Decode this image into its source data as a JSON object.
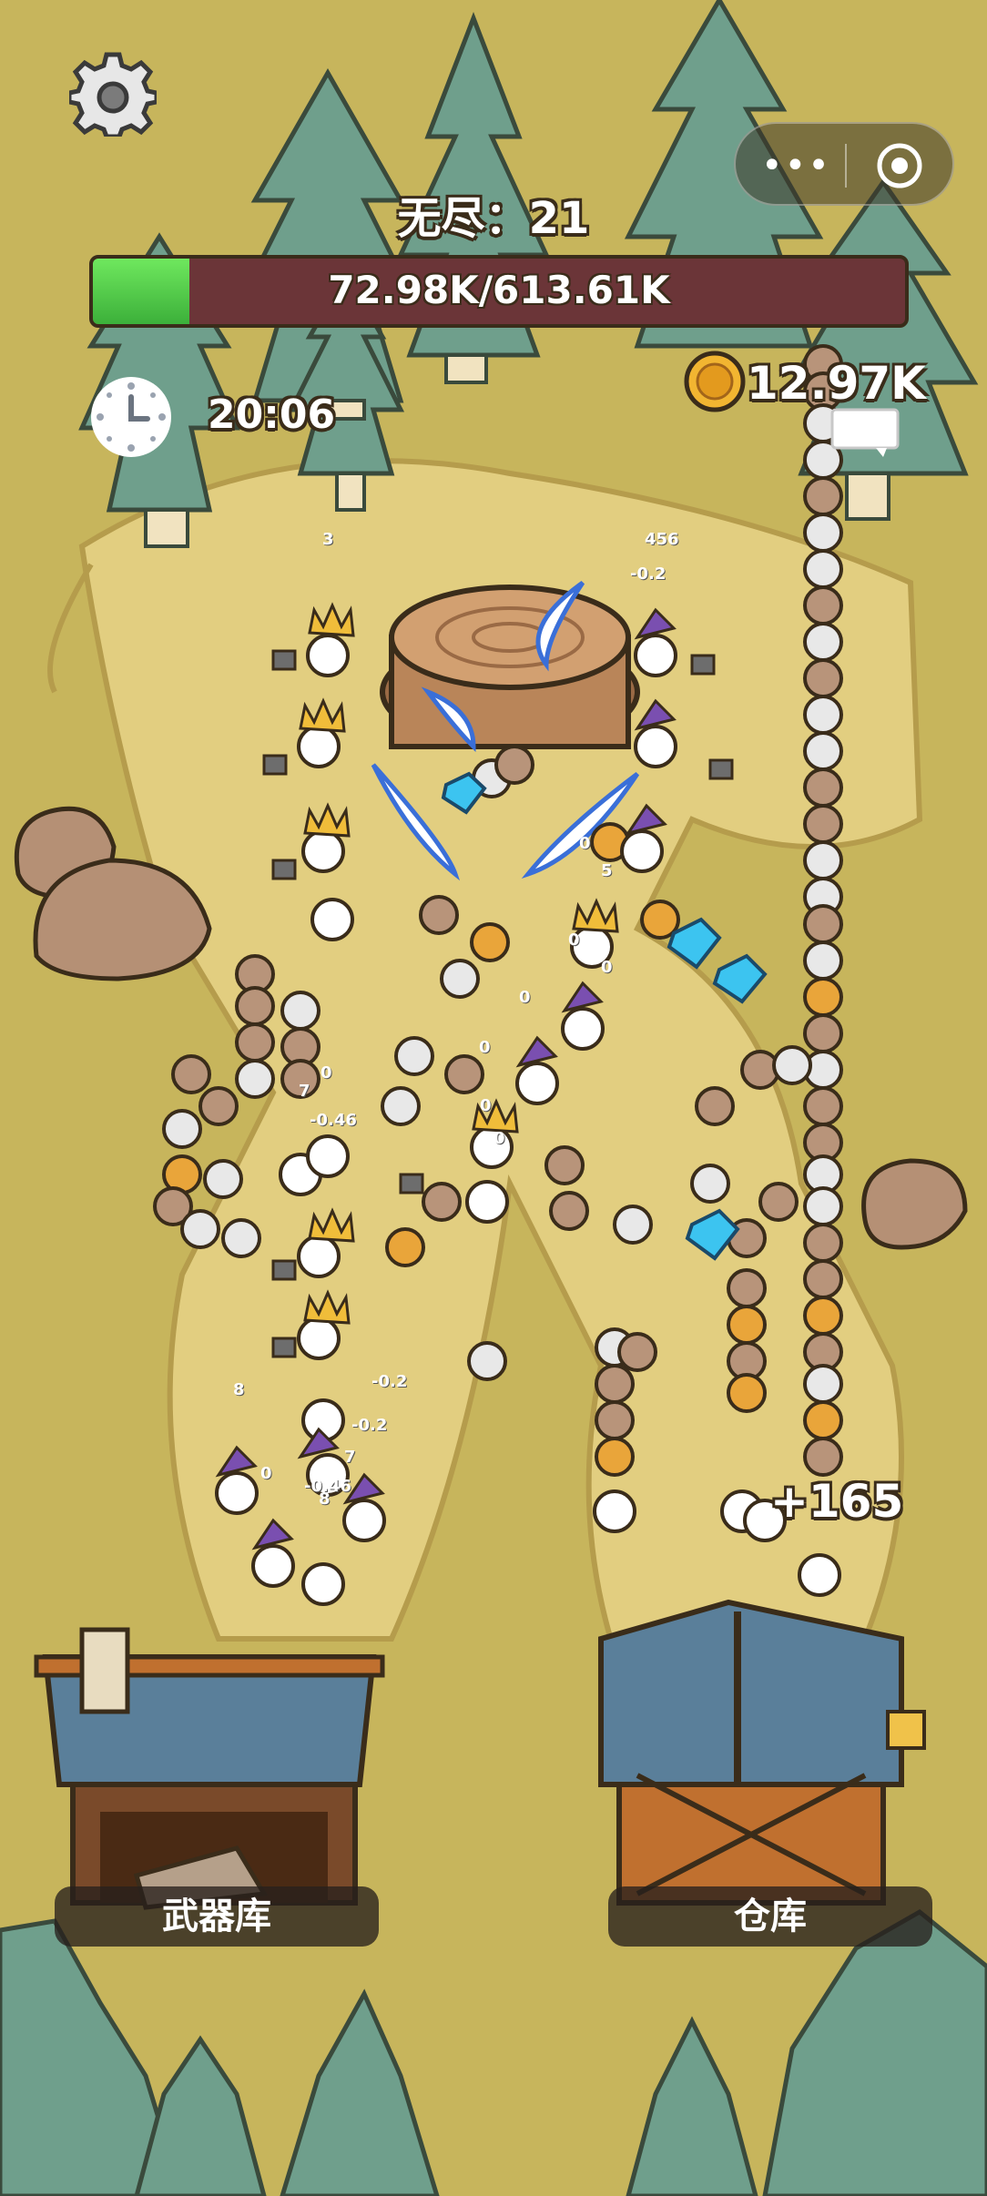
{
  "hud": {
    "wave_label": "无尽：21",
    "boss_hp": {
      "text": "72.98K/613.61K",
      "current": 72.98,
      "max": 613.61,
      "unit": "K",
      "fill_fraction": 0.119
    },
    "timer": "20:06",
    "gold": "12.97K"
  },
  "wechat_capsule": {
    "menu_icon": "more-dots-icon",
    "close_icon": "target-close-icon"
  },
  "buildings": {
    "armory_label": "武器库",
    "warehouse_label": "仓库"
  },
  "floating": {
    "bonus": "+165",
    "damage_numbers": [
      "3",
      "456",
      "-0.2",
      "0",
      "5",
      "0",
      "0",
      "0",
      "0",
      "7",
      "-0.46",
      "0",
      "0",
      "8",
      "-0.2",
      "-0.2",
      "7",
      "0",
      "-0.46",
      "8",
      "0"
    ]
  },
  "icons": [
    "gear-icon",
    "clock-icon",
    "gold-coin-icon",
    "chat-bubble-icon"
  ],
  "colors": {
    "hp_fill": "#4fd046",
    "hp_bg": "#6b3538",
    "ground": "#c7b55c",
    "path": "#e0cc7c",
    "tree": "#6f9f8c"
  }
}
